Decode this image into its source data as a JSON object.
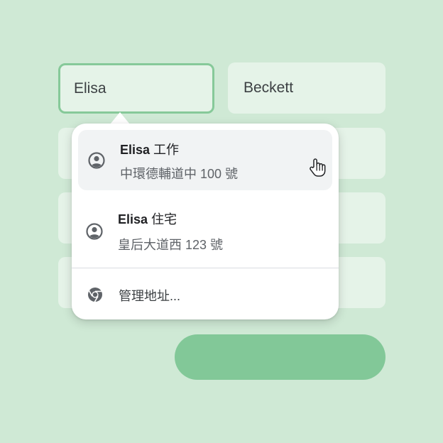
{
  "form": {
    "first_name_value": "Elisa",
    "last_name_value": "Beckett"
  },
  "dropdown": {
    "suggestions": [
      {
        "name": "Elisa",
        "label": "工作",
        "address": "中環德輔道中 100 號",
        "icon": "account-circle-icon"
      },
      {
        "name": "Elisa",
        "label": "住宅",
        "address": "皇后大道西 123 號",
        "icon": "account-circle-icon"
      }
    ],
    "manage_label": "管理地址...",
    "manage_icon": "chrome-icon"
  },
  "colors": {
    "background": "#cfe9d5",
    "field": "#e5f3e8",
    "focus_border": "#86c999",
    "button": "#82c898",
    "highlight": "#f1f3f4"
  }
}
